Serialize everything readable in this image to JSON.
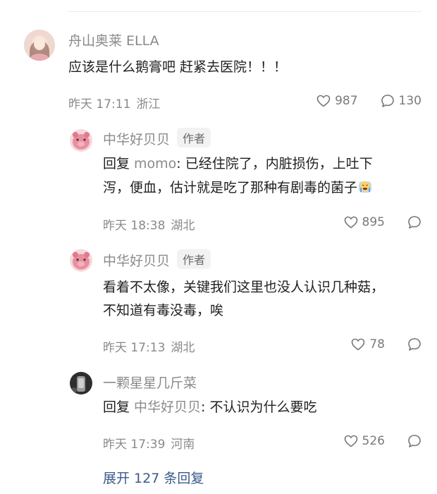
{
  "comments": [
    {
      "name": "舟山奥莱 ELLA",
      "text_lines": [
        "应该是什么鹅膏吧 赶紧去医院！！！"
      ],
      "time": "昨天 17:11",
      "location": "浙江",
      "likes": "987",
      "replies": "130"
    }
  ],
  "replies": [
    {
      "name": "中华好贝贝",
      "tag": "作者",
      "reply_prefix": "回复",
      "reply_to": "momo",
      "text_line1": ": 已经住院了，内脏损伤，上吐下",
      "text_line2": "泻，便血，估计就是吃了那种有剧毒的菌子",
      "emoji_icon": "crying-face-icon",
      "time": "昨天 18:38",
      "location": "湖北",
      "likes": "895"
    },
    {
      "name": "中华好贝贝",
      "tag": "作者",
      "text_line1": "看着不太像，关键我们这里也没人认识几种菇，",
      "text_line2": "不知道有毒没毒，唉",
      "time": "昨天 17:13",
      "location": "湖北",
      "likes": "78"
    },
    {
      "name": "一颗星星几斤菜",
      "reply_prefix": "回复",
      "reply_to": "中华好贝贝",
      "text_line1": ": 不认识为什么要吃",
      "time": "昨天 17:39",
      "location": "河南",
      "likes": "526"
    }
  ],
  "expand_label": "展开 127 条回复",
  "colors": {
    "link": "#3a5a8a",
    "muted": "#8a8a8a",
    "text": "#1f1f1f"
  }
}
